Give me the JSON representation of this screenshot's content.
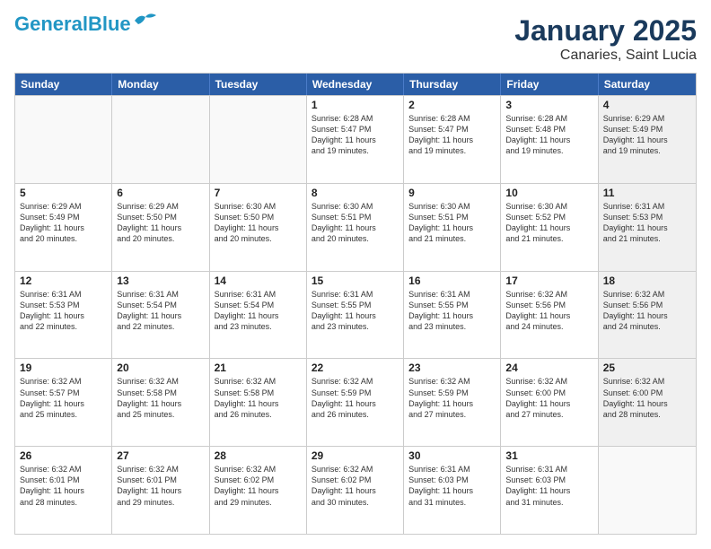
{
  "header": {
    "logo_line1": "General",
    "logo_line2": "Blue",
    "month": "January 2025",
    "location": "Canaries, Saint Lucia"
  },
  "dow": [
    "Sunday",
    "Monday",
    "Tuesday",
    "Wednesday",
    "Thursday",
    "Friday",
    "Saturday"
  ],
  "weeks": [
    [
      {
        "num": "",
        "info": "",
        "empty": true
      },
      {
        "num": "",
        "info": "",
        "empty": true
      },
      {
        "num": "",
        "info": "",
        "empty": true
      },
      {
        "num": "1",
        "info": "Sunrise: 6:28 AM\nSunset: 5:47 PM\nDaylight: 11 hours\nand 19 minutes."
      },
      {
        "num": "2",
        "info": "Sunrise: 6:28 AM\nSunset: 5:47 PM\nDaylight: 11 hours\nand 19 minutes."
      },
      {
        "num": "3",
        "info": "Sunrise: 6:28 AM\nSunset: 5:48 PM\nDaylight: 11 hours\nand 19 minutes."
      },
      {
        "num": "4",
        "info": "Sunrise: 6:29 AM\nSunset: 5:49 PM\nDaylight: 11 hours\nand 19 minutes.",
        "shaded": true
      }
    ],
    [
      {
        "num": "5",
        "info": "Sunrise: 6:29 AM\nSunset: 5:49 PM\nDaylight: 11 hours\nand 20 minutes."
      },
      {
        "num": "6",
        "info": "Sunrise: 6:29 AM\nSunset: 5:50 PM\nDaylight: 11 hours\nand 20 minutes."
      },
      {
        "num": "7",
        "info": "Sunrise: 6:30 AM\nSunset: 5:50 PM\nDaylight: 11 hours\nand 20 minutes."
      },
      {
        "num": "8",
        "info": "Sunrise: 6:30 AM\nSunset: 5:51 PM\nDaylight: 11 hours\nand 20 minutes."
      },
      {
        "num": "9",
        "info": "Sunrise: 6:30 AM\nSunset: 5:51 PM\nDaylight: 11 hours\nand 21 minutes."
      },
      {
        "num": "10",
        "info": "Sunrise: 6:30 AM\nSunset: 5:52 PM\nDaylight: 11 hours\nand 21 minutes."
      },
      {
        "num": "11",
        "info": "Sunrise: 6:31 AM\nSunset: 5:53 PM\nDaylight: 11 hours\nand 21 minutes.",
        "shaded": true
      }
    ],
    [
      {
        "num": "12",
        "info": "Sunrise: 6:31 AM\nSunset: 5:53 PM\nDaylight: 11 hours\nand 22 minutes."
      },
      {
        "num": "13",
        "info": "Sunrise: 6:31 AM\nSunset: 5:54 PM\nDaylight: 11 hours\nand 22 minutes."
      },
      {
        "num": "14",
        "info": "Sunrise: 6:31 AM\nSunset: 5:54 PM\nDaylight: 11 hours\nand 23 minutes."
      },
      {
        "num": "15",
        "info": "Sunrise: 6:31 AM\nSunset: 5:55 PM\nDaylight: 11 hours\nand 23 minutes."
      },
      {
        "num": "16",
        "info": "Sunrise: 6:31 AM\nSunset: 5:55 PM\nDaylight: 11 hours\nand 23 minutes."
      },
      {
        "num": "17",
        "info": "Sunrise: 6:32 AM\nSunset: 5:56 PM\nDaylight: 11 hours\nand 24 minutes."
      },
      {
        "num": "18",
        "info": "Sunrise: 6:32 AM\nSunset: 5:56 PM\nDaylight: 11 hours\nand 24 minutes.",
        "shaded": true
      }
    ],
    [
      {
        "num": "19",
        "info": "Sunrise: 6:32 AM\nSunset: 5:57 PM\nDaylight: 11 hours\nand 25 minutes."
      },
      {
        "num": "20",
        "info": "Sunrise: 6:32 AM\nSunset: 5:58 PM\nDaylight: 11 hours\nand 25 minutes."
      },
      {
        "num": "21",
        "info": "Sunrise: 6:32 AM\nSunset: 5:58 PM\nDaylight: 11 hours\nand 26 minutes."
      },
      {
        "num": "22",
        "info": "Sunrise: 6:32 AM\nSunset: 5:59 PM\nDaylight: 11 hours\nand 26 minutes."
      },
      {
        "num": "23",
        "info": "Sunrise: 6:32 AM\nSunset: 5:59 PM\nDaylight: 11 hours\nand 27 minutes."
      },
      {
        "num": "24",
        "info": "Sunrise: 6:32 AM\nSunset: 6:00 PM\nDaylight: 11 hours\nand 27 minutes."
      },
      {
        "num": "25",
        "info": "Sunrise: 6:32 AM\nSunset: 6:00 PM\nDaylight: 11 hours\nand 28 minutes.",
        "shaded": true
      }
    ],
    [
      {
        "num": "26",
        "info": "Sunrise: 6:32 AM\nSunset: 6:01 PM\nDaylight: 11 hours\nand 28 minutes."
      },
      {
        "num": "27",
        "info": "Sunrise: 6:32 AM\nSunset: 6:01 PM\nDaylight: 11 hours\nand 29 minutes."
      },
      {
        "num": "28",
        "info": "Sunrise: 6:32 AM\nSunset: 6:02 PM\nDaylight: 11 hours\nand 29 minutes."
      },
      {
        "num": "29",
        "info": "Sunrise: 6:32 AM\nSunset: 6:02 PM\nDaylight: 11 hours\nand 30 minutes."
      },
      {
        "num": "30",
        "info": "Sunrise: 6:31 AM\nSunset: 6:03 PM\nDaylight: 11 hours\nand 31 minutes."
      },
      {
        "num": "31",
        "info": "Sunrise: 6:31 AM\nSunset: 6:03 PM\nDaylight: 11 hours\nand 31 minutes."
      },
      {
        "num": "",
        "info": "",
        "empty": true
      }
    ]
  ]
}
